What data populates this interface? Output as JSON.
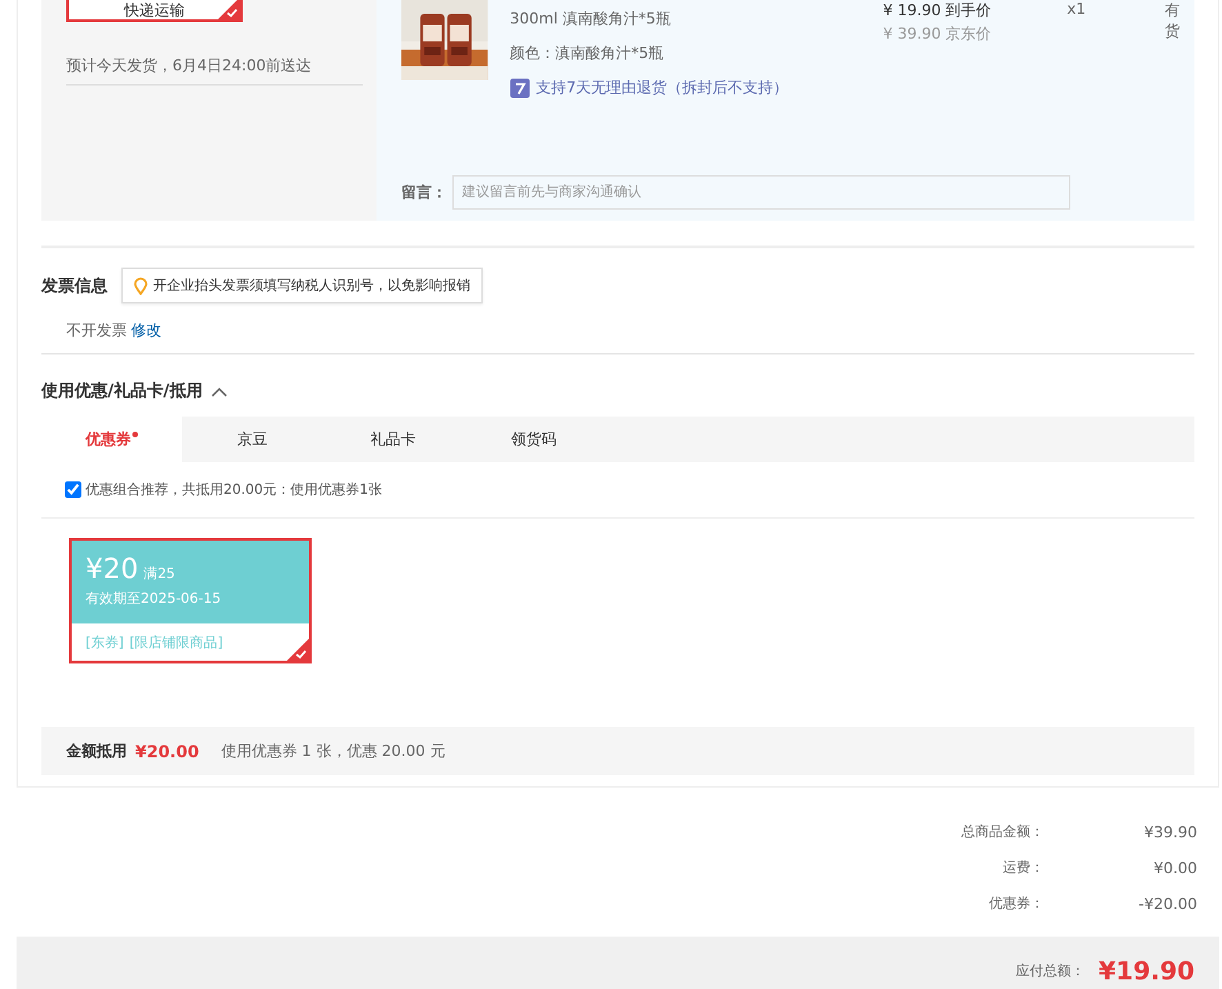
{
  "shipping": {
    "method": {
      "label": "快递运输",
      "selected": true
    },
    "estimate": "预计今天发货，6月4日24:00前送达"
  },
  "product": {
    "title": "300ml 滇南酸角汁*5瓶",
    "spec": "颜色：滇南酸角汁*5瓶",
    "return_policy": "支持7天无理由退货（拆封后不支持）",
    "price": "¥ 19.90 到手价",
    "jd_price": "¥ 39.90 京东价",
    "quantity": "x1",
    "stock": "有货",
    "message": {
      "label": "留言：",
      "placeholder": "建议留言前先与商家沟通确认"
    }
  },
  "invoice": {
    "title": "发票信息",
    "tip": "开企业抬头发票须填写纳税人识别号，以免影响报销",
    "status": "不开发票",
    "edit_link": "修改"
  },
  "discounts": {
    "title": "使用优惠/礼品卡/抵用",
    "expanded": true,
    "tabs": [
      {
        "label": "优惠券",
        "selected": true,
        "dot": true
      },
      {
        "label": "京豆",
        "selected": false,
        "dot": false
      },
      {
        "label": "礼品卡",
        "selected": false,
        "dot": false
      },
      {
        "label": "领货码",
        "selected": false,
        "dot": false
      }
    ],
    "recommend": {
      "label": "优惠组合推荐，共抵用20.00元：使用优惠券1张",
      "checked": true
    },
    "coupons": [
      {
        "amount": "¥20",
        "condition": "满25",
        "validity": "有效期至2025-06-15",
        "tags": [
          "[东券]",
          "[限店铺限商品]"
        ],
        "selected": true
      }
    ],
    "summary": {
      "label": "金额抵用",
      "amount": "¥20.00",
      "detail": "使用优惠券 1 张，优惠 20.00 元"
    }
  },
  "totals": [
    {
      "label": "总商品金额：",
      "value": "¥39.90"
    },
    {
      "label": "运费：",
      "value": "¥0.00"
    },
    {
      "label": "优惠券：",
      "value": "-¥20.00"
    }
  ],
  "payable": {
    "label": "应付总额：",
    "value": "¥19.90"
  }
}
